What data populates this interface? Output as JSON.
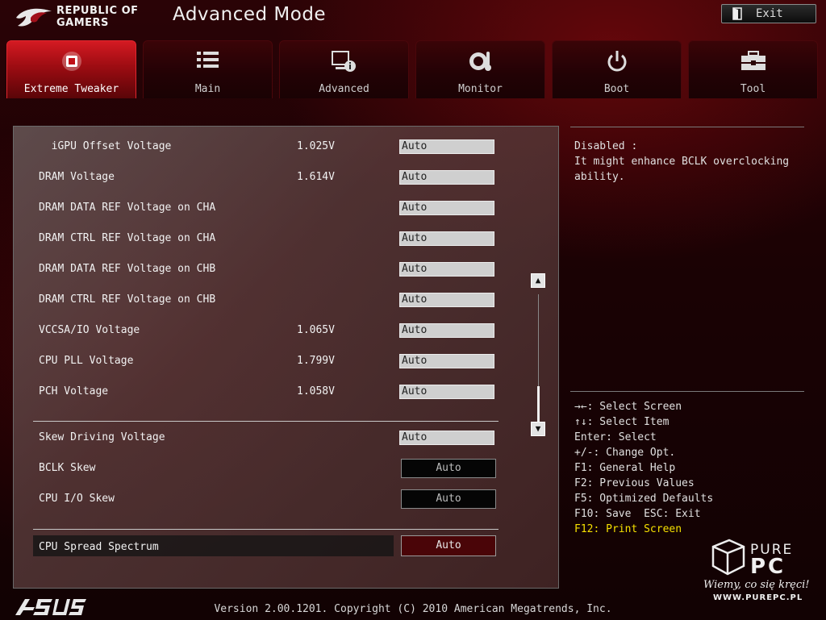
{
  "header": {
    "brand_line1": "REPUBLIC OF",
    "brand_line2": "GAMERS",
    "mode_title": "Advanced Mode",
    "exit_label": "Exit"
  },
  "tabs": [
    {
      "label": "Extreme Tweaker",
      "icon": "tweaker-icon",
      "active": true
    },
    {
      "label": "Main",
      "icon": "list-icon",
      "active": false
    },
    {
      "label": "Advanced",
      "icon": "advanced-info-icon",
      "active": false
    },
    {
      "label": "Monitor",
      "icon": "monitor-gauge-icon",
      "active": false
    },
    {
      "label": "Boot",
      "icon": "power-icon",
      "active": false
    },
    {
      "label": "Tool",
      "icon": "toolbox-icon",
      "active": false
    }
  ],
  "settings": [
    {
      "label": "  iGPU Offset Voltage",
      "value": "1.025V",
      "option": "Auto"
    },
    {
      "label": "DRAM Voltage",
      "value": "1.614V",
      "option": "Auto"
    },
    {
      "label": "DRAM DATA REF Voltage on CHA",
      "value": "",
      "option": "Auto"
    },
    {
      "label": "DRAM CTRL REF Voltage on CHA",
      "value": "",
      "option": "Auto"
    },
    {
      "label": "DRAM DATA REF Voltage on CHB",
      "value": "",
      "option": "Auto"
    },
    {
      "label": "DRAM CTRL REF Voltage on CHB",
      "value": "",
      "option": "Auto"
    },
    {
      "label": "VCCSA/IO Voltage",
      "value": "1.065V",
      "option": "Auto"
    },
    {
      "label": "CPU PLL Voltage",
      "value": "1.799V",
      "option": "Auto"
    },
    {
      "label": "PCH Voltage",
      "value": "1.058V",
      "option": "Auto"
    },
    {
      "label": "Skew Driving Voltage",
      "value": "",
      "option": "Auto"
    },
    {
      "label": "BCLK Skew",
      "value": "",
      "option": "Auto"
    },
    {
      "label": "CPU I/O Skew",
      "value": "",
      "option": "Auto"
    },
    {
      "label": "CPU Spread Spectrum",
      "value": "",
      "option": "Auto"
    }
  ],
  "help": {
    "line1": "Disabled :",
    "line2": "It might enhance BCLK overclocking",
    "line3": "ability."
  },
  "keys": [
    "→←: Select Screen",
    "↑↓: Select Item",
    "Enter: Select",
    "+/-: Change Opt.",
    "F1: General Help",
    "F2: Previous Values",
    "F5: Optimized Defaults",
    "F10: Save  ESC: Exit",
    "F12: Print Screen"
  ],
  "footer": {
    "version": "Version 2.00.1201. Copyright (C) 2010 American Megatrends, Inc.",
    "vendor_logo": "ASUS"
  },
  "watermark": {
    "pure": "PURE",
    "pc": "PC",
    "slogan": "Wiemy, co się kręci!",
    "url": "WWW.PUREPC.PL"
  },
  "colors": {
    "accent_red": "#d41a22",
    "highlight_key": "#f5e000"
  }
}
